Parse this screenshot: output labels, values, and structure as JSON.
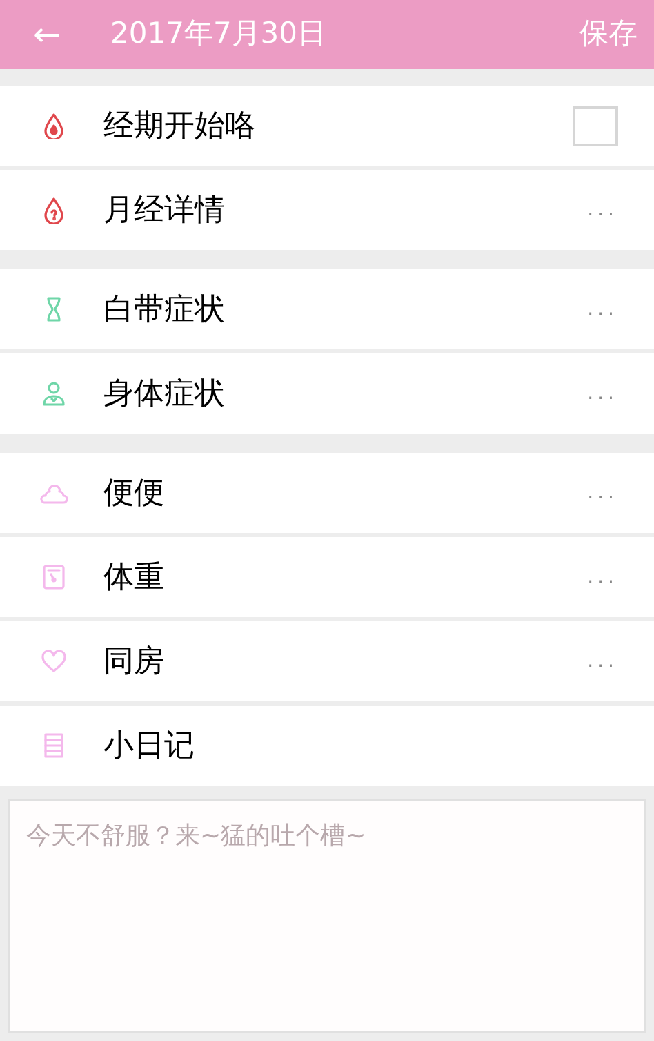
{
  "header": {
    "back": "←",
    "title": "2017年7月30日",
    "save": "保存"
  },
  "groups": [
    {
      "rows": [
        {
          "label": "经期开始咯",
          "kind": "checkbox",
          "checked": false
        },
        {
          "label": "月经详情",
          "kind": "more",
          "more": "..."
        }
      ]
    },
    {
      "rows": [
        {
          "label": "白带症状",
          "kind": "more",
          "more": "..."
        },
        {
          "label": "身体症状",
          "kind": "more",
          "more": "..."
        }
      ]
    },
    {
      "rows": [
        {
          "label": "便便",
          "kind": "more",
          "more": "..."
        },
        {
          "label": "体重",
          "kind": "more",
          "more": "..."
        },
        {
          "label": "同房",
          "kind": "more",
          "more": "..."
        },
        {
          "label": "小日记",
          "kind": "plain"
        }
      ]
    }
  ],
  "diary": {
    "placeholder": "今天不舒服？来~猛的吐个槽~"
  }
}
